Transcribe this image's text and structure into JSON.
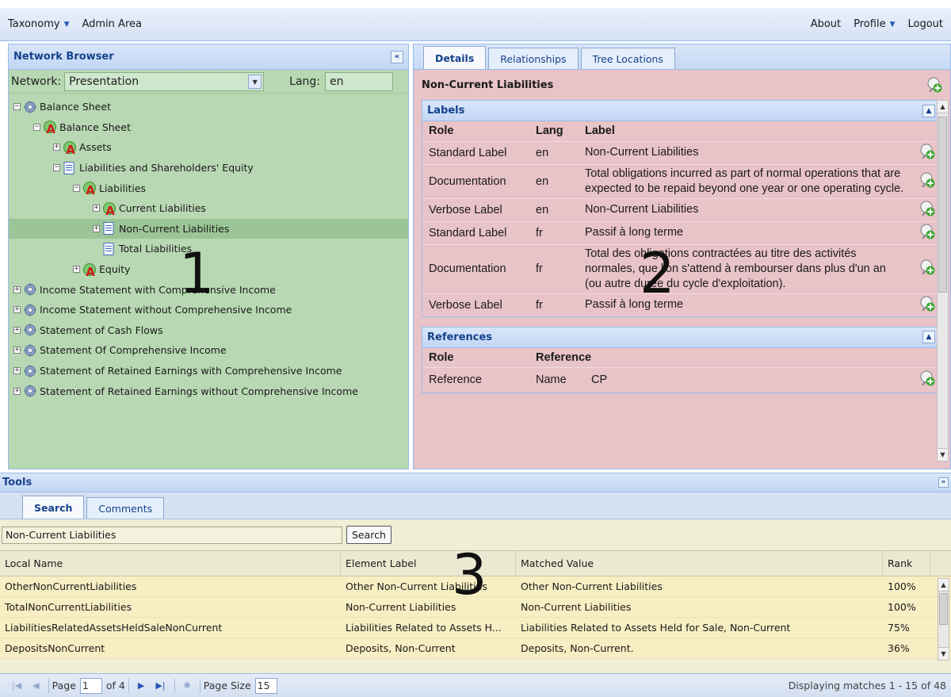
{
  "topbar": {
    "taxonomy": "Taxonomy",
    "admin": "Admin Area",
    "about": "About",
    "profile": "Profile",
    "logout": "Logout"
  },
  "network_browser": {
    "title": "Network Browser",
    "network_label": "Network:",
    "network_value": "Presentation",
    "lang_label": "Lang:",
    "lang_value": "en",
    "nodes": [
      {
        "label": "Balance Sheet",
        "toggle": "minus",
        "icon": "gear-icon"
      },
      {
        "label": "Balance Sheet",
        "toggle": "minus",
        "icon": "abstract-icon"
      },
      {
        "label": "Assets",
        "toggle": "plus",
        "icon": "abstract-icon"
      },
      {
        "label": "Liabilities and Shareholders' Equity",
        "toggle": "minus",
        "icon": "document-icon"
      },
      {
        "label": "Liabilities",
        "toggle": "minus",
        "icon": "abstract-icon"
      },
      {
        "label": "Current Liabilities",
        "toggle": "plus",
        "icon": "abstract-icon"
      },
      {
        "label": "Non-Current Liabilities",
        "toggle": "plus",
        "icon": "document-icon",
        "selected": true
      },
      {
        "label": "Total Liabilities",
        "toggle": "none",
        "icon": "document-icon"
      },
      {
        "label": "Equity",
        "toggle": "plus",
        "icon": "abstract-icon"
      },
      {
        "label": "Income Statement with Comprehensive Income",
        "toggle": "plus",
        "icon": "gear-icon"
      },
      {
        "label": "Income Statement without Comprehensive Income",
        "toggle": "plus",
        "icon": "gear-icon"
      },
      {
        "label": "Statement of Cash Flows",
        "toggle": "plus",
        "icon": "gear-icon"
      },
      {
        "label": "Statement Of Comprehensive Income",
        "toggle": "plus",
        "icon": "gear-icon"
      },
      {
        "label": "Statement of Retained Earnings with Comprehensive Income",
        "toggle": "plus",
        "icon": "gear-icon"
      },
      {
        "label": "Statement of Retained Earnings without Comprehensive Income",
        "toggle": "plus",
        "icon": "gear-icon"
      }
    ]
  },
  "annotations": {
    "one": "1",
    "two": "2",
    "three": "3"
  },
  "details": {
    "tabs": [
      "Details",
      "Relationships",
      "Tree Locations"
    ],
    "concept_title": "Non-Current Liabilities",
    "labels_section": {
      "title": "Labels",
      "headers": [
        "Role",
        "Lang",
        "Label"
      ],
      "rows": [
        {
          "role": "Standard Label",
          "lang": "en",
          "label": "Non-Current Liabilities"
        },
        {
          "role": "Documentation",
          "lang": "en",
          "label": "Total obligations incurred as part of normal operations that are expected to be repaid beyond one year or one operating cycle."
        },
        {
          "role": "Verbose Label",
          "lang": "en",
          "label": "Non-Current Liabilities"
        },
        {
          "role": "Standard Label",
          "lang": "fr",
          "label": "Passif à long terme"
        },
        {
          "role": "Documentation",
          "lang": "fr",
          "label": "Total des obligations contractées au titre des activités normales, que l'on s'attend à rembourser dans plus d'un an (ou autre durée du cycle d'exploitation)."
        },
        {
          "role": "Verbose Label",
          "lang": "fr",
          "label": "Passif à long terme"
        }
      ]
    },
    "references_section": {
      "title": "References",
      "headers": [
        "Role",
        "Reference"
      ],
      "rows": [
        {
          "role": "Reference",
          "name": "Name",
          "value": "CP"
        }
      ]
    }
  },
  "tools": {
    "title": "Tools",
    "tabs": [
      "Search",
      "Comments"
    ],
    "search_value": "Non-Current Liabilities",
    "search_button": "Search",
    "columns": [
      "Local Name",
      "Element Label",
      "Matched Value",
      "Rank"
    ],
    "rows": [
      {
        "local": "OtherNonCurrentLiabilities",
        "label": "Other Non-Current Liabilities",
        "matched": "Other Non-Current Liabilities",
        "rank": "100%"
      },
      {
        "local": "TotalNonCurrentLiabilities",
        "label": "Non-Current Liabilities",
        "matched": "Non-Current Liabilities",
        "rank": "100%"
      },
      {
        "local": "LiabilitiesRelatedAssetsHeldSaleNonCurrent",
        "label": "Liabilities Related to Assets H...",
        "matched": "Liabilities Related to Assets Held for Sale, Non-Current",
        "rank": "75%"
      },
      {
        "local": "DepositsNonCurrent",
        "label": "Deposits, Non-Current",
        "matched": "Deposits, Non-Current.",
        "rank": "36%"
      }
    ],
    "pager": {
      "page_label": "Page",
      "page_value": "1",
      "of_label": "of 4",
      "page_size_label": "Page Size",
      "page_size_value": "15",
      "status": "Displaying matches 1 - 15 of 48"
    }
  },
  "colors": {
    "left_panel": "#b7d8b2",
    "right_panel": "#e8c3c8",
    "tools_panel": "#f1eed6",
    "header_text": "#15428b"
  }
}
